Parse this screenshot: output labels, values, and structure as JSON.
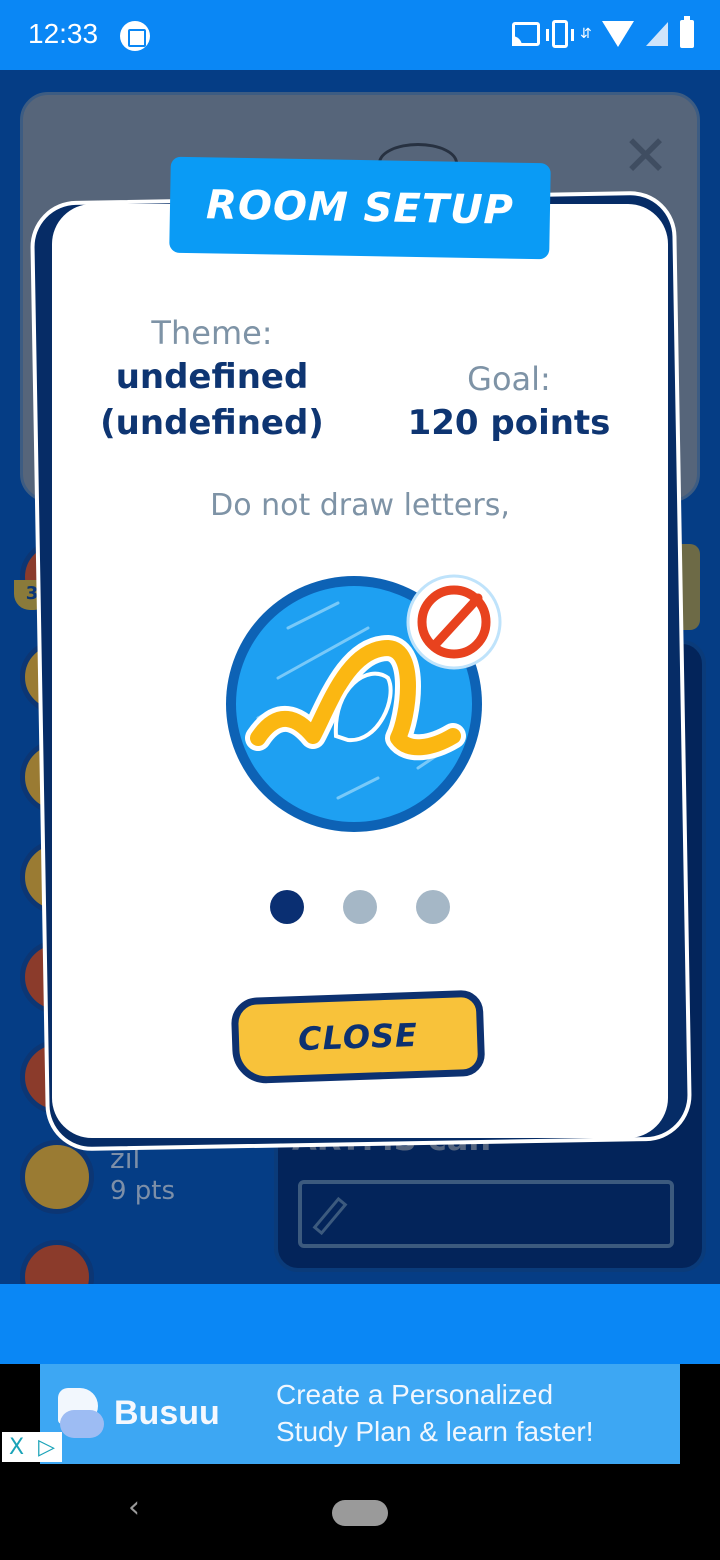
{
  "status_bar": {
    "time": "12:33",
    "icons": [
      "screenshot-edit-icon",
      "cast-icon",
      "vibrate-icon",
      "data-arrows-icon",
      "wifi-icon",
      "signal-icon",
      "battery-icon"
    ]
  },
  "background": {
    "players": [
      {
        "name": "",
        "points": "",
        "rank": "3"
      },
      {
        "name": "",
        "points": ""
      },
      {
        "name": "",
        "points": ""
      },
      {
        "name": "",
        "points": ""
      },
      {
        "name": "",
        "points": ""
      },
      {
        "name": "",
        "points": ""
      },
      {
        "name": "zil",
        "points": "9 pts"
      }
    ],
    "chat_partial_text": "ARTMS can"
  },
  "modal": {
    "title": "ROOM SETUP",
    "theme_label": "Theme:",
    "theme_value": "undefined (undefined)",
    "theme_value_line1": "undefined",
    "theme_value_line2": "(undefined)",
    "goal_label": "Goal:",
    "goal_value": "120 points",
    "rule_text": "Do not draw letters,",
    "rule_icon": "no-letters-icon",
    "pager": {
      "total": 3,
      "active_index": 0
    },
    "close_label": "CLOSE"
  },
  "ad": {
    "brand": "Busuu",
    "line1": "Create a Personalized",
    "line2": "Study Plan & learn faster!",
    "choices_close": "X",
    "choices_icon": "ad-choices-icon"
  },
  "colors": {
    "status_bar": "#0a87f5",
    "title_tab": "#0a9bf5",
    "text_dark": "#0e3572",
    "text_muted": "#7e93a6",
    "close_button": "#f8c23a",
    "dot_active": "#0a2f72",
    "dot_inactive": "#a5b7c6"
  }
}
